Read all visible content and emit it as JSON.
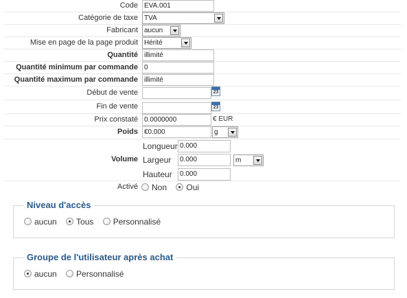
{
  "fields": {
    "code": {
      "label": "Code",
      "value": "EVA.001"
    },
    "tax_category": {
      "label": "Catégorie de taxe",
      "value": "TVA"
    },
    "manufacturer": {
      "label": "Fabricant",
      "value": "aucun"
    },
    "page_layout": {
      "label": "Mise en page de la page produit",
      "value": "Hérité"
    },
    "quantity": {
      "label": "Quantité",
      "value": "illimité"
    },
    "min_qty": {
      "label": "Quantité minimum par commande",
      "value": "0"
    },
    "max_qty": {
      "label": "Quantité maximum par commande",
      "value": "illimité"
    },
    "sale_start": {
      "label": "Début de vente",
      "value": "",
      "calendar_day": "23"
    },
    "sale_end": {
      "label": "Fin de vente",
      "value": "",
      "calendar_day": "23"
    },
    "price": {
      "label": "Prix constaté",
      "value": "0.0000000",
      "unit": "€ EUR"
    },
    "weight": {
      "label": "Poids",
      "value": "€0.000",
      "unit": "g"
    },
    "volume": {
      "label": "Volume",
      "length": {
        "label": "Longueur",
        "value": "0.000"
      },
      "width": {
        "label": "Largeur",
        "value": "0.000"
      },
      "height": {
        "label": "Hauteur",
        "value": "0.000"
      },
      "unit": "m"
    },
    "active": {
      "label": "Activé",
      "options": [
        "Non",
        "Oui"
      ],
      "selected": "Oui"
    }
  },
  "access_level": {
    "legend": "Niveau d'accès",
    "options": [
      "aucun",
      "Tous",
      "Personnalisé"
    ],
    "selected": "Tous"
  },
  "user_group": {
    "legend": "Groupe de l'utilisateur après achat",
    "options": [
      "aucun",
      "Personnalisé"
    ],
    "selected": "aucun"
  }
}
